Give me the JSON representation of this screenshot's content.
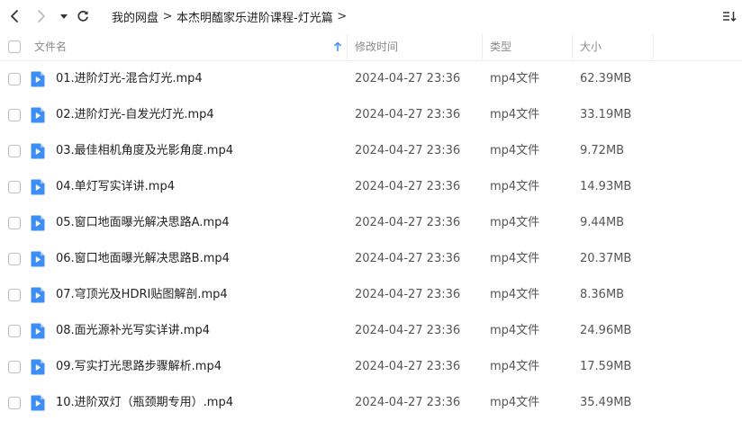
{
  "toolbar": {
    "breadcrumb": [
      "我的网盘",
      "本杰明醢家乐进阶课程-灯光篇"
    ],
    "back_icon": "chevron-left-icon",
    "forward_icon": "chevron-right-icon",
    "history_icon": "caret-down-icon",
    "refresh_icon": "refresh-icon",
    "sort_icon": "sort-list-icon"
  },
  "columns": {
    "name": "文件名",
    "time": "修改时间",
    "type": "类型",
    "size": "大小",
    "sort_indicator_icon": "sort-ascending-arrow-icon"
  },
  "colors": {
    "file_icon": "#3d8ff5",
    "accent": "#3d8ff5"
  },
  "files": [
    {
      "name": "01.进阶灯光-混合灯光.mp4",
      "time": "2024-04-27 23:36",
      "type": "mp4文件",
      "size": "62.39MB",
      "icon": "video-file-icon"
    },
    {
      "name": "02.进阶灯光-自发光灯光.mp4",
      "time": "2024-04-27 23:36",
      "type": "mp4文件",
      "size": "33.19MB",
      "icon": "video-file-icon"
    },
    {
      "name": "03.最佳相机角度及光影角度.mp4",
      "time": "2024-04-27 23:36",
      "type": "mp4文件",
      "size": "9.72MB",
      "icon": "video-file-icon"
    },
    {
      "name": "04.单灯写实详讲.mp4",
      "time": "2024-04-27 23:36",
      "type": "mp4文件",
      "size": "14.93MB",
      "icon": "video-file-icon"
    },
    {
      "name": "05.窗口地面曝光解决思路A.mp4",
      "time": "2024-04-27 23:36",
      "type": "mp4文件",
      "size": "9.44MB",
      "icon": "video-file-icon"
    },
    {
      "name": "06.窗口地面曝光解决思路B.mp4",
      "time": "2024-04-27 23:36",
      "type": "mp4文件",
      "size": "20.37MB",
      "icon": "video-file-icon"
    },
    {
      "name": "07.穹顶光及HDRI贴图解剖.mp4",
      "time": "2024-04-27 23:36",
      "type": "mp4文件",
      "size": "8.36MB",
      "icon": "video-file-icon"
    },
    {
      "name": "08.面光源补光写实详讲.mp4",
      "time": "2024-04-27 23:36",
      "type": "mp4文件",
      "size": "24.96MB",
      "icon": "video-file-icon"
    },
    {
      "name": "09.写实打光思路步骤解析.mp4",
      "time": "2024-04-27 23:36",
      "type": "mp4文件",
      "size": "17.59MB",
      "icon": "video-file-icon"
    },
    {
      "name": "10.进阶双灯（瓶颈期专用）.mp4",
      "time": "2024-04-27 23:36",
      "type": "mp4文件",
      "size": "35.49MB",
      "icon": "video-file-icon"
    }
  ]
}
